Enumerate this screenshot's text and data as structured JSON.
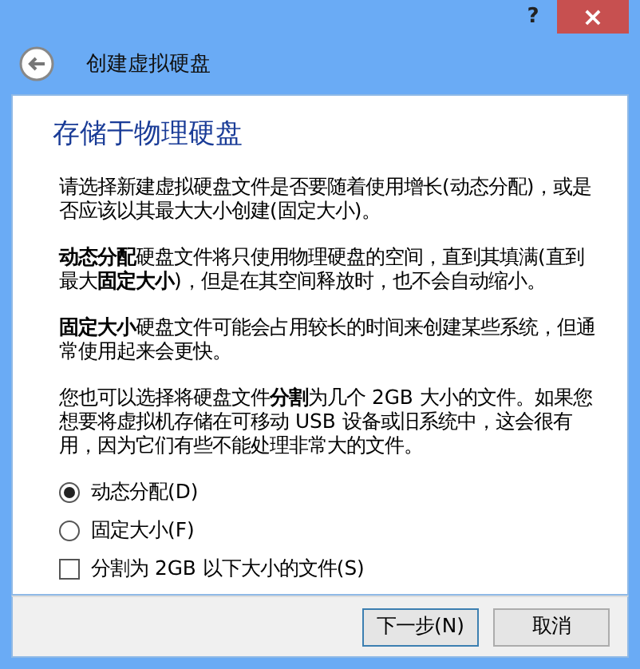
{
  "window": {
    "help": "?",
    "close": "×"
  },
  "header": {
    "title": "创建虚拟硬盘"
  },
  "heading": "存储于物理硬盘",
  "paragraphs": [
    "请选择新建虚拟硬盘文件是否要随着使用增长(动态分配)，或是否应该以其最大大小创建(固定大小)。",
    "**动态分配**硬盘文件将只使用物理硬盘的空间，直到其填满(直到最大**固定大小**)，但是在其空间释放时，也不会自动缩小。",
    "**固定大小**硬盘文件可能会占用较长的时间来创建某些系统，但通常使用起来会更快。",
    "您也可以选择将硬盘文件**分割**为几个 2GB 大小的文件。如果您想要将虚拟机存储在可移动 USB 设备或旧系统中，这会很有用，因为它们有些不能处理非常大的文件。"
  ],
  "options": [
    {
      "kind": "radio",
      "label": "动态分配(D)",
      "selected": true
    },
    {
      "kind": "radio",
      "label": "固定大小(F)",
      "selected": false
    },
    {
      "kind": "checkbox",
      "label": "分割为 2GB 以下大小的文件(S)",
      "checked": false
    }
  ],
  "buttons": [
    {
      "label": "下一步(N)",
      "default": true
    },
    {
      "label": "取消",
      "default": false
    }
  ]
}
